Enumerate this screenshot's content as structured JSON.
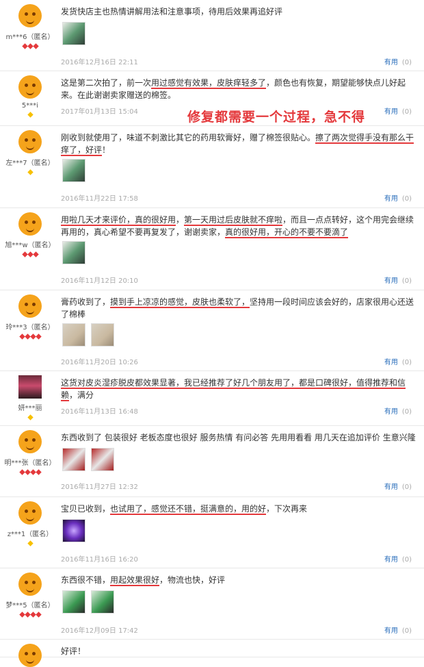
{
  "helpful_label": "有用",
  "annotation": "修复都需要一个过程，急不得",
  "reviews": [
    {
      "user": "m***6（匿名）",
      "badge": "red",
      "badge_count": 3,
      "segments": [
        {
          "t": "发货快店主也热情讲解用法和注意事项，待用后效果再追好评",
          "u": false
        }
      ],
      "images": [
        "green-tube-photo"
      ],
      "date": "2016年12月16日 22:11",
      "helpful_count": "(0)"
    },
    {
      "user": "5***i",
      "badge": "yellow",
      "badge_count": 1,
      "segments": [
        {
          "t": "这是第二次拍了，前一次",
          "u": false
        },
        {
          "t": "用过感觉有效果，皮肤痒轻多了",
          "u": true
        },
        {
          "t": "，颜色也有恢复，期望能够快点儿好起来。在此谢谢卖家赠送的棉签。",
          "u": false
        }
      ],
      "images": [],
      "date": "2017年01月13日 15:04",
      "helpful_count": "(0)"
    },
    {
      "user": "左***7（匿名）",
      "badge": "yellow",
      "badge_count": 1,
      "segments": [
        {
          "t": "刚收到就使用了，味道不刺激比其它的药用软膏好，赠了棉签很贴心。",
          "u": false
        },
        {
          "t": "擦了两次觉得手没有那么干痒了，好评",
          "u": true
        },
        {
          "t": "！",
          "u": false
        }
      ],
      "images": [
        "green-tube-photo"
      ],
      "date": "2016年11月22日 17:58",
      "helpful_count": "(0)"
    },
    {
      "user": "旭***w（匿名）",
      "badge": "red",
      "badge_count": 3,
      "segments": [
        {
          "t": "用啦几天才来评价，真的很好用",
          "u": true
        },
        {
          "t": "，",
          "u": false
        },
        {
          "t": "第一天用过后皮肤就不痒啦",
          "u": true
        },
        {
          "t": "，而且一点点转好，这个用完会继续再用的，真心希望不要再复发了，谢谢卖家，",
          "u": false
        },
        {
          "t": "真的很好用，开心的不要不要滴了",
          "u": true
        }
      ],
      "images": [
        "green-tube-photo"
      ],
      "date": "2016年11月12日 20:10",
      "helpful_count": "(0)"
    },
    {
      "user": "玲***3（匿名）",
      "badge": "red",
      "badge_count": 4,
      "segments": [
        {
          "t": "膏药收到了，",
          "u": false
        },
        {
          "t": "摸到手上凉凉的感觉，皮肤也柔软了，",
          "u": true
        },
        {
          "t": "坚持用一段时间应该会好的，店家很用心还送了棉棒",
          "u": false
        }
      ],
      "images": [
        "cream-jar-photo",
        "cream-jar-photo-2"
      ],
      "date": "2016年11月20日 10:26",
      "helpful_count": "(0)"
    },
    {
      "user": "妍***丽",
      "badge": "yellow",
      "badge_count": 1,
      "segments": [
        {
          "t": "这货对皮炎湿疹脱皮都效果显著，我已经推荐了好几个朋友用了，都是口碑很好，值得推荐和信赖",
          "u": true
        },
        {
          "t": "，满分",
          "u": false
        }
      ],
      "images": [],
      "date": "2016年11月13日 16:48",
      "helpful_count": "(0)"
    },
    {
      "user": "明***张（匿名）",
      "badge": "red",
      "badge_count": 4,
      "segments": [
        {
          "t": "东西收到了 包装很好 老板态度也很好 服务热情 有问必答 先用用看看 用几天在追加评价 生意兴隆",
          "u": false
        }
      ],
      "images": [
        "red-box-photo",
        "red-box-photo-2"
      ],
      "date": "2016年11月27日 12:32",
      "helpful_count": "(0)"
    },
    {
      "user": "z***1（匿名）",
      "badge": "yellow",
      "badge_count": 1,
      "segments": [
        {
          "t": "宝贝已收到，",
          "u": false
        },
        {
          "t": "也试用了，感觉还不错，挺满意的，用的好",
          "u": true
        },
        {
          "t": "，下次再来",
          "u": false
        }
      ],
      "images": [
        "purple-light-photo"
      ],
      "date": "2016年11月16日 16:20",
      "helpful_count": "(0)"
    },
    {
      "user": "梦***5（匿名）",
      "badge": "red",
      "badge_count": 4,
      "segments": [
        {
          "t": "东西很不错，",
          "u": false
        },
        {
          "t": "用起效果很好",
          "u": true
        },
        {
          "t": "，物流也快，好评",
          "u": false
        }
      ],
      "images": [
        "green-cap-photo",
        "green-cap-photo-2"
      ],
      "date": "2016年12月09日 17:42",
      "helpful_count": "(0)"
    },
    {
      "user": "",
      "badge": "none",
      "badge_count": 0,
      "segments": [
        {
          "t": "好评！",
          "u": false
        }
      ],
      "images": [],
      "date": "",
      "helpful_count": ""
    }
  ]
}
